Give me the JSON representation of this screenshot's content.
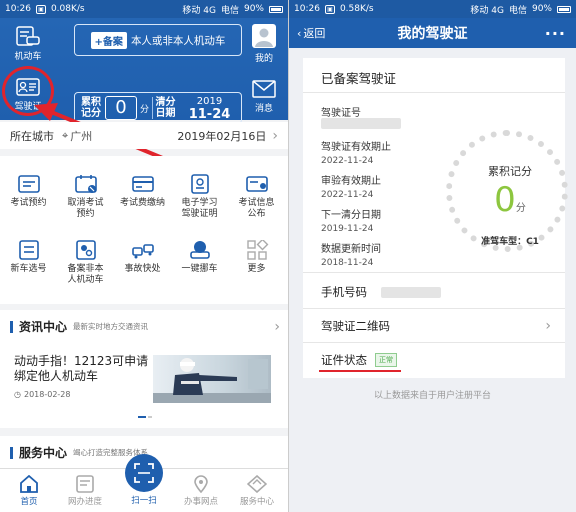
{
  "left": {
    "status": {
      "time": "10:26",
      "speed": "0.08K/s",
      "carrier1": "移动 4G",
      "carrier2": "电信",
      "battery": "90%"
    },
    "header": {
      "motor_label": "机动车",
      "register_tag": "+备案",
      "register_text": "本人或非本人机动车",
      "mine_label": "我的",
      "license_label": "驾驶证",
      "score_label_1": "累积",
      "score_label_2": "记分",
      "score_value": "0",
      "score_unit": "分",
      "clear_label_1": "清分",
      "clear_label_2": "日期",
      "clear_year": "2019",
      "clear_md": "11-24",
      "message_label": "消息"
    },
    "city": {
      "label": "所在城市",
      "value": "广州",
      "date": "2019年02月16日"
    },
    "grid": [
      {
        "l1": "考试预约",
        "l2": ""
      },
      {
        "l1": "取消考试",
        "l2": "预约"
      },
      {
        "l1": "考试费缴纳",
        "l2": ""
      },
      {
        "l1": "电子学习",
        "l2": "驾驶证明"
      },
      {
        "l1": "考试信息",
        "l2": "公布"
      },
      {
        "l1": "新车选号",
        "l2": ""
      },
      {
        "l1": "备案非本",
        "l2": "人机动车"
      },
      {
        "l1": "事故快处",
        "l2": ""
      },
      {
        "l1": "一键挪车",
        "l2": ""
      },
      {
        "l1": "更多",
        "l2": ""
      }
    ],
    "news": {
      "title": "资讯中心",
      "subtitle": "最新实时地方交通资讯",
      "headline_1": "动动手指！12123可申请",
      "headline_2": "绑定他人机动车",
      "date": "2018-02-28"
    },
    "service": {
      "title": "服务中心",
      "subtitle": "竭心打造完整服务体系"
    },
    "tabs": {
      "home": "首页",
      "progress": "网办进度",
      "scan": "扫一扫",
      "points": "办事网点",
      "center": "服务中心"
    }
  },
  "right": {
    "status": {
      "time": "10:26",
      "speed": "0.58K/s",
      "carrier1": "移动 4G",
      "carrier2": "电信",
      "battery": "90%"
    },
    "header": {
      "back": "返回",
      "title": "我的驾驶证",
      "more": "···"
    },
    "card": {
      "title": "已备案驾驶证",
      "license_no_label": "驾驶证号",
      "valid_until_label": "驾驶证有效期止",
      "valid_until": "2022-11-24",
      "review_label": "审验有效期止",
      "review_until": "2022-11-24",
      "next_clear_label": "下一清分日期",
      "next_clear": "2019-11-24",
      "updated_label": "数据更新时间",
      "updated": "2018-11-24",
      "gauge_label": "累积记分",
      "gauge_value": "0",
      "gauge_unit": "分",
      "vehicle_type": "准驾车型：C1",
      "phone_label": "手机号码",
      "qr_label": "驾驶证二维码",
      "status_label": "证件状态",
      "status_value": "正常"
    },
    "footer": "以上数据来自于用户注册平台"
  }
}
